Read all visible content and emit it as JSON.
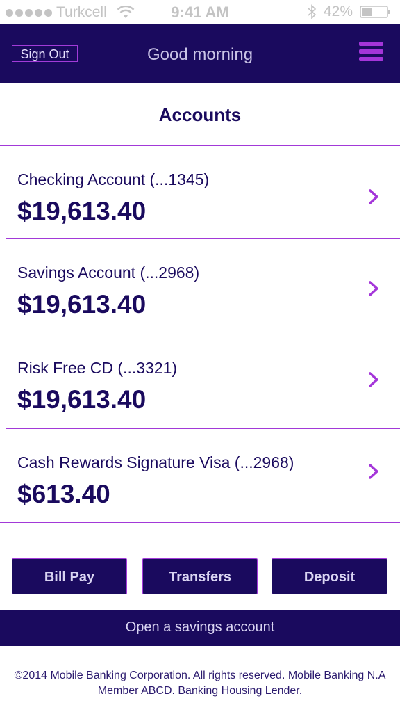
{
  "status_bar": {
    "carrier": "Turkcell",
    "time": "9:41 AM",
    "battery": "42%"
  },
  "header": {
    "sign_out_label": "Sign Out",
    "title": "Good morning",
    "menu_icon": "hamburger-menu-icon"
  },
  "accounts": {
    "title": "Accounts",
    "items": [
      {
        "name": "Checking Account (...1345)",
        "balance": "$19,613.40"
      },
      {
        "name": "Savings Account (...2968)",
        "balance": "$19,613.40"
      },
      {
        "name": "Risk Free CD (...3321)",
        "balance": "$19,613.40"
      },
      {
        "name": "Cash Rewards Signature Visa  (...2968)",
        "balance": "$613.40"
      }
    ]
  },
  "actions": {
    "bill_pay": "Bill Pay",
    "transfers": "Transfers",
    "deposit": "Deposit",
    "open_savings": "Open a savings account"
  },
  "footer": {
    "text": "©2014 Mobile Banking Corporation. All rights reserved. Mobile Banking N.A Member ABCD. Banking Housing Lender."
  },
  "colors": {
    "primary": "#1a0a5e",
    "accent": "#a239d8",
    "background": "#ffffff"
  }
}
